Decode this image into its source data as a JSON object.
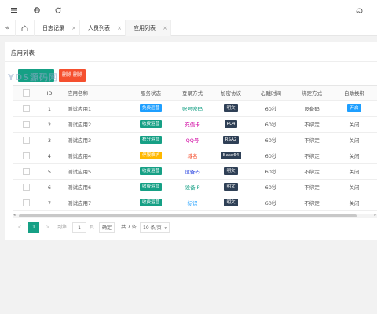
{
  "topbar": {
    "icons": [
      "menu-icon",
      "globe-icon",
      "refresh-icon",
      "skin-icon"
    ]
  },
  "tabs": {
    "items": [
      {
        "label": "日志记录"
      },
      {
        "label": "人员列表"
      },
      {
        "label": "应用列表"
      }
    ],
    "close_glyph": "×"
  },
  "panel": {
    "title": "应用列表",
    "watermark": "YDS源码网",
    "add_label": "",
    "delete_label": "删除 删除"
  },
  "table": {
    "headers": [
      "ID",
      "应用名称",
      "服务状态",
      "登录方式",
      "加密协议",
      "心跳时间",
      "绑定方式",
      "自助换绑"
    ],
    "rows": [
      {
        "id": "1",
        "name": "测试应用1",
        "status": "免费运营",
        "status_color": "#1e9fff",
        "login": "账号密码",
        "login_color": "#16a085",
        "enc": "明文",
        "hb": "60秒",
        "bind": "设备码",
        "rebind": "开启",
        "rebind_tag": true
      },
      {
        "id": "2",
        "name": "测试应用2",
        "status": "收费运营",
        "status_color": "#16a085",
        "login": "充值卡",
        "login_color": "#d000a0",
        "enc": "RC4",
        "hb": "60秒",
        "bind": "不绑定",
        "rebind": "关闭",
        "rebind_tag": false
      },
      {
        "id": "3",
        "name": "测试应用3",
        "status": "积分运营",
        "status_color": "#16a085",
        "login": "QQ号",
        "login_color": "#d000a0",
        "enc": "RSA2",
        "hb": "60秒",
        "bind": "不绑定",
        "rebind": "关闭",
        "rebind_tag": false
      },
      {
        "id": "4",
        "name": "测试应用4",
        "status": "停服维护",
        "status_color": "#ffb800",
        "login": "域名",
        "login_color": "#f5502f",
        "enc": "Base64",
        "hb": "60秒",
        "bind": "不绑定",
        "rebind": "关闭",
        "rebind_tag": false
      },
      {
        "id": "5",
        "name": "测试应用5",
        "status": "收费运营",
        "status_color": "#16a085",
        "login": "设备码",
        "login_color": "#1e3adf",
        "enc": "明文",
        "hb": "60秒",
        "bind": "不绑定",
        "rebind": "关闭",
        "rebind_tag": false
      },
      {
        "id": "6",
        "name": "测试应用6",
        "status": "收费运营",
        "status_color": "#16a085",
        "login": "设备IP",
        "login_color": "#16a085",
        "enc": "明文",
        "hb": "60秒",
        "bind": "不绑定",
        "rebind": "关闭",
        "rebind_tag": false
      },
      {
        "id": "7",
        "name": "测试应用7",
        "status": "收费运营",
        "status_color": "#16a085",
        "login": "标识",
        "login_color": "#1e9fff",
        "enc": "明文",
        "hb": "60秒",
        "bind": "不绑定",
        "rebind": "关闭",
        "rebind_tag": false
      }
    ]
  },
  "pager": {
    "prev": "<",
    "current": "1",
    "next": ">",
    "goto_label": "到第",
    "goto_value": "1",
    "page_unit": "页",
    "confirm": "确定",
    "total": "共 7 条",
    "page_size": "10 条/页"
  },
  "colors": {
    "primary": "#16a085",
    "danger": "#f5502f",
    "enc_tag": "#2f4056"
  }
}
